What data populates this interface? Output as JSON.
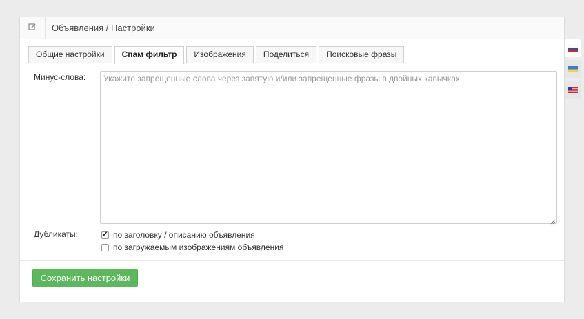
{
  "header": {
    "title": "Объявления / Настройки",
    "icon": "edit-icon"
  },
  "tabs": [
    {
      "label": "Общие настройки",
      "active": false
    },
    {
      "label": "Спам фильтр",
      "active": true
    },
    {
      "label": "Изображения",
      "active": false
    },
    {
      "label": "Поделиться",
      "active": false
    },
    {
      "label": "Поисковые фразы",
      "active": false
    }
  ],
  "form": {
    "minus_words": {
      "label": "Минус-слова:",
      "value": "",
      "placeholder": "Укажите запрещенные слова через запятую и/или запрещенные фразы в двойных кавычках"
    },
    "duplicates": {
      "label": "Дубликаты:",
      "options": [
        {
          "label": "по заголовку / описанию объявления",
          "checked": true
        },
        {
          "label": "по загружаемым изображениям объявления",
          "checked": false
        }
      ]
    },
    "save_label": "Сохранить настройки"
  },
  "languages": [
    {
      "code": "ru",
      "icon": "flag-ru-icon",
      "active": true
    },
    {
      "code": "ua",
      "icon": "flag-ua-icon",
      "active": false
    },
    {
      "code": "en",
      "icon": "flag-us-icon",
      "active": false
    }
  ],
  "colors": {
    "accent": "#5cb85c",
    "background": "#ececec",
    "panel": "#ffffff"
  }
}
